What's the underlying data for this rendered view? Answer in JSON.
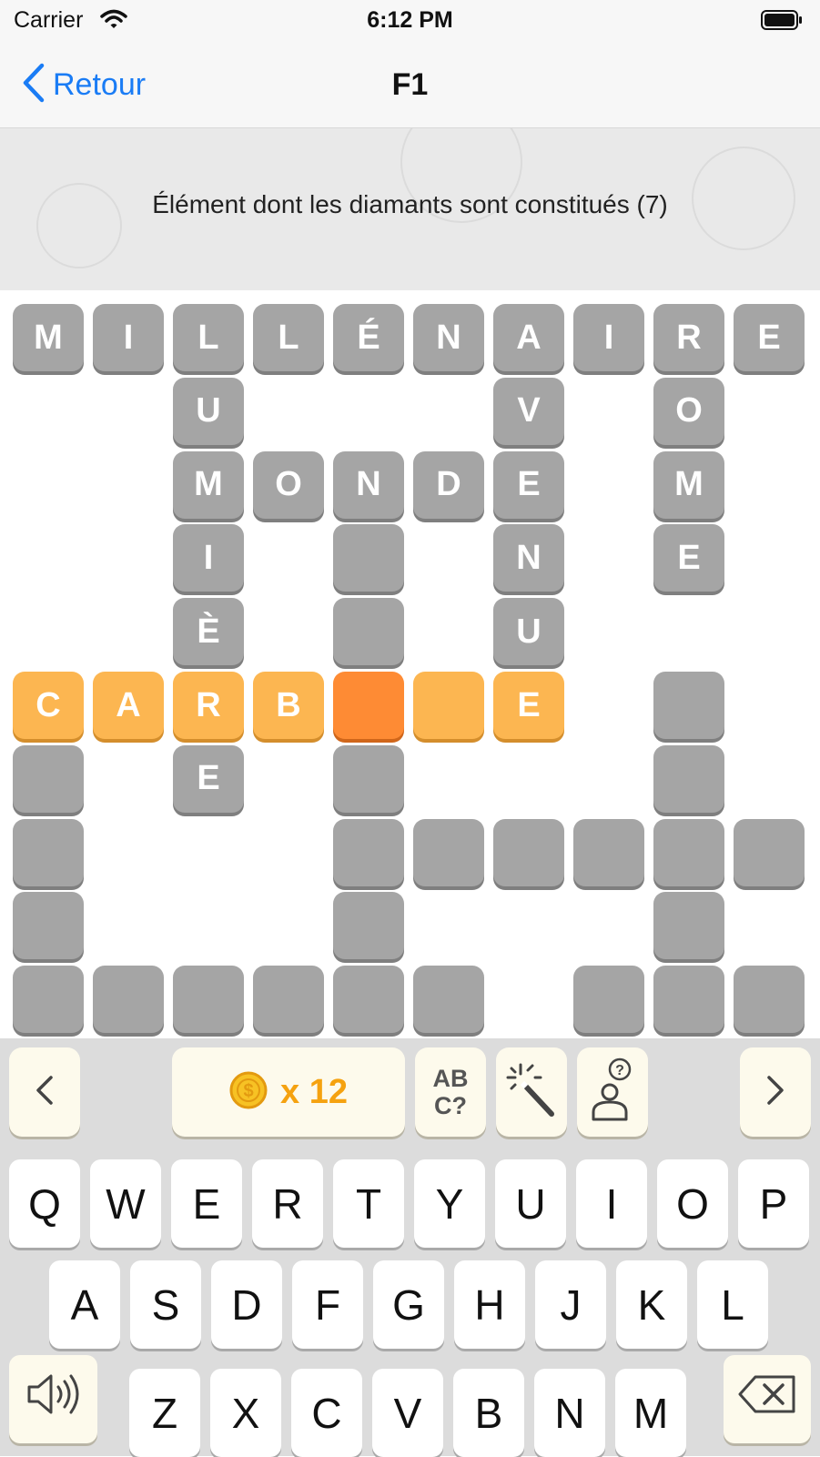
{
  "status_bar": {
    "carrier": "Carrier",
    "time": "6:12 PM"
  },
  "nav": {
    "back_label": "Retour",
    "title": "F1"
  },
  "clue": {
    "text": "Élément dont les diamants sont constitués (7)"
  },
  "colors": {
    "cell_empty": "#a5a5a5",
    "cell_highlight": "#fcb651",
    "cell_current": "#fe8b34",
    "accent_link": "#1a7cf5",
    "coin": "#f5a210"
  },
  "grid": {
    "columns": 10,
    "rows": 10,
    "cells": [
      {
        "row": 0,
        "col": 0,
        "letter": "M",
        "state": "filled"
      },
      {
        "row": 0,
        "col": 1,
        "letter": "I",
        "state": "filled"
      },
      {
        "row": 0,
        "col": 2,
        "letter": "L",
        "state": "filled"
      },
      {
        "row": 0,
        "col": 3,
        "letter": "L",
        "state": "filled"
      },
      {
        "row": 0,
        "col": 4,
        "letter": "É",
        "state": "filled"
      },
      {
        "row": 0,
        "col": 5,
        "letter": "N",
        "state": "filled"
      },
      {
        "row": 0,
        "col": 6,
        "letter": "A",
        "state": "filled"
      },
      {
        "row": 0,
        "col": 7,
        "letter": "I",
        "state": "filled"
      },
      {
        "row": 0,
        "col": 8,
        "letter": "R",
        "state": "filled"
      },
      {
        "row": 0,
        "col": 9,
        "letter": "E",
        "state": "filled"
      },
      {
        "row": 1,
        "col": 2,
        "letter": "U",
        "state": "filled"
      },
      {
        "row": 1,
        "col": 6,
        "letter": "V",
        "state": "filled"
      },
      {
        "row": 1,
        "col": 8,
        "letter": "O",
        "state": "filled"
      },
      {
        "row": 2,
        "col": 2,
        "letter": "M",
        "state": "filled"
      },
      {
        "row": 2,
        "col": 3,
        "letter": "O",
        "state": "filled"
      },
      {
        "row": 2,
        "col": 4,
        "letter": "N",
        "state": "filled"
      },
      {
        "row": 2,
        "col": 5,
        "letter": "D",
        "state": "filled"
      },
      {
        "row": 2,
        "col": 6,
        "letter": "E",
        "state": "filled"
      },
      {
        "row": 2,
        "col": 8,
        "letter": "M",
        "state": "filled"
      },
      {
        "row": 3,
        "col": 2,
        "letter": "I",
        "state": "filled"
      },
      {
        "row": 3,
        "col": 4,
        "letter": "",
        "state": "filled"
      },
      {
        "row": 3,
        "col": 6,
        "letter": "N",
        "state": "filled"
      },
      {
        "row": 3,
        "col": 8,
        "letter": "E",
        "state": "filled"
      },
      {
        "row": 4,
        "col": 2,
        "letter": "È",
        "state": "filled"
      },
      {
        "row": 4,
        "col": 4,
        "letter": "",
        "state": "filled"
      },
      {
        "row": 4,
        "col": 6,
        "letter": "U",
        "state": "filled"
      },
      {
        "row": 5,
        "col": 0,
        "letter": "C",
        "state": "highlight"
      },
      {
        "row": 5,
        "col": 1,
        "letter": "A",
        "state": "highlight"
      },
      {
        "row": 5,
        "col": 2,
        "letter": "R",
        "state": "highlight"
      },
      {
        "row": 5,
        "col": 3,
        "letter": "B",
        "state": "highlight"
      },
      {
        "row": 5,
        "col": 4,
        "letter": "",
        "state": "current"
      },
      {
        "row": 5,
        "col": 5,
        "letter": "",
        "state": "highlight"
      },
      {
        "row": 5,
        "col": 6,
        "letter": "E",
        "state": "highlight"
      },
      {
        "row": 5,
        "col": 8,
        "letter": "",
        "state": "filled"
      },
      {
        "row": 6,
        "col": 0,
        "letter": "",
        "state": "filled"
      },
      {
        "row": 6,
        "col": 2,
        "letter": "E",
        "state": "filled"
      },
      {
        "row": 6,
        "col": 4,
        "letter": "",
        "state": "filled"
      },
      {
        "row": 6,
        "col": 8,
        "letter": "",
        "state": "filled"
      },
      {
        "row": 7,
        "col": 0,
        "letter": "",
        "state": "filled"
      },
      {
        "row": 7,
        "col": 4,
        "letter": "",
        "state": "filled"
      },
      {
        "row": 7,
        "col": 5,
        "letter": "",
        "state": "filled"
      },
      {
        "row": 7,
        "col": 6,
        "letter": "",
        "state": "filled"
      },
      {
        "row": 7,
        "col": 7,
        "letter": "",
        "state": "filled"
      },
      {
        "row": 7,
        "col": 8,
        "letter": "",
        "state": "filled"
      },
      {
        "row": 7,
        "col": 9,
        "letter": "",
        "state": "filled"
      },
      {
        "row": 8,
        "col": 0,
        "letter": "",
        "state": "filled"
      },
      {
        "row": 8,
        "col": 4,
        "letter": "",
        "state": "filled"
      },
      {
        "row": 8,
        "col": 8,
        "letter": "",
        "state": "filled"
      },
      {
        "row": 9,
        "col": 0,
        "letter": "",
        "state": "filled"
      },
      {
        "row": 9,
        "col": 1,
        "letter": "",
        "state": "filled"
      },
      {
        "row": 9,
        "col": 2,
        "letter": "",
        "state": "filled"
      },
      {
        "row": 9,
        "col": 3,
        "letter": "",
        "state": "filled"
      },
      {
        "row": 9,
        "col": 4,
        "letter": "",
        "state": "filled"
      },
      {
        "row": 9,
        "col": 5,
        "letter": "",
        "state": "filled"
      },
      {
        "row": 9,
        "col": 7,
        "letter": "",
        "state": "filled"
      },
      {
        "row": 9,
        "col": 8,
        "letter": "",
        "state": "filled"
      },
      {
        "row": 9,
        "col": 9,
        "letter": "",
        "state": "filled"
      }
    ]
  },
  "toolbar": {
    "prev_label": "<",
    "next_label": ">",
    "coin_label": "x 12",
    "letter_hint_label": "AB\nC?",
    "icons": [
      "coin-icon",
      "magic-wand-icon",
      "ask-friend-icon"
    ]
  },
  "keyboard": {
    "rows": [
      [
        "Q",
        "W",
        "E",
        "R",
        "T",
        "Y",
        "U",
        "I",
        "O",
        "P"
      ],
      [
        "A",
        "S",
        "D",
        "F",
        "G",
        "H",
        "J",
        "K",
        "L"
      ],
      [
        "Z",
        "X",
        "C",
        "V",
        "B",
        "N",
        "M"
      ]
    ],
    "special_icons": [
      "speaker-icon",
      "backspace-icon"
    ]
  }
}
